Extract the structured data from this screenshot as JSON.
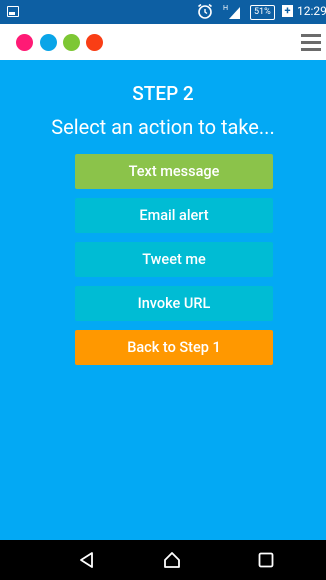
{
  "status_bar": {
    "battery": "51%",
    "charging_plus": "+",
    "time": "12:29",
    "icons": [
      "gallery-icon",
      "alarm-icon",
      "signal-icon",
      "battery-icon"
    ]
  },
  "header": {
    "dots": [
      {
        "name": "pink-dot",
        "color": "#FF1A75"
      },
      {
        "name": "blue-dot",
        "color": "#0AA5E8"
      },
      {
        "name": "green-dot",
        "color": "#7DC734"
      },
      {
        "name": "red-dot",
        "color": "#F93E15"
      }
    ],
    "menu_icon": "hamburger-menu-icon"
  },
  "main": {
    "step_title": "STEP 2",
    "subtitle": "Select an action to take...",
    "buttons": [
      {
        "label": "Text message",
        "color": "#8BC34A"
      },
      {
        "label": "Email alert",
        "color": "#00BCD4"
      },
      {
        "label": "Tweet me",
        "color": "#00BCD4"
      },
      {
        "label": "Invoke URL",
        "color": "#00BCD4"
      },
      {
        "label": "Back to Step 1",
        "color": "#FF9800"
      }
    ]
  },
  "colors": {
    "background": "#03A9F4",
    "status_bar": "#0D5FA3",
    "nav_bar": "#000000"
  },
  "nav_bar": {
    "icons": [
      "back-icon",
      "home-icon",
      "recents-icon"
    ]
  }
}
